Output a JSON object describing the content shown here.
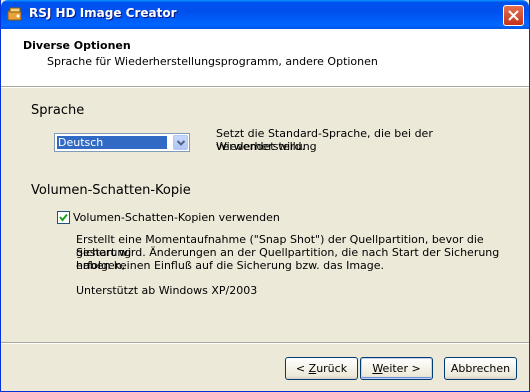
{
  "window": {
    "title": "RSJ HD Image Creator"
  },
  "header": {
    "title": "Diverse Optionen",
    "subtitle": "Sprache für Wiederherstellungsprogramm, andere Optionen"
  },
  "language": {
    "heading": "Sprache",
    "selected": "Deutsch",
    "description_line1": "Setzt die Standard-Sprache, die bei der Wiederherstellung",
    "description_line2": "verwendet wird."
  },
  "vss": {
    "heading": "Volumen-Schatten-Kopie",
    "checkbox_label": "Volumen-Schatten-Kopien verwenden",
    "checked": true,
    "description_lines": [
      "Erstellt eine Momentaufnahme (\"Snap Shot\") der Quellpartition, bevor die Sicherung",
      "gestart wird. Änderungen an der Quellpartition, die nach Start der Sicherung erfolgen,",
      "haben keinen Einfluß auf die Sicherung bzw. das Image."
    ],
    "support_note": "Unterstützt ab Windows XP/2003"
  },
  "buttons": {
    "back_prefix": "< ",
    "back_mnemonic": "Z",
    "back_rest": "urück",
    "next_mnemonic": "W",
    "next_rest": "eiter >",
    "cancel": "Abbrechen"
  },
  "colors": {
    "titlebar": "#0054e3",
    "selection": "#316ac5",
    "window_bg": "#ece9d8"
  }
}
